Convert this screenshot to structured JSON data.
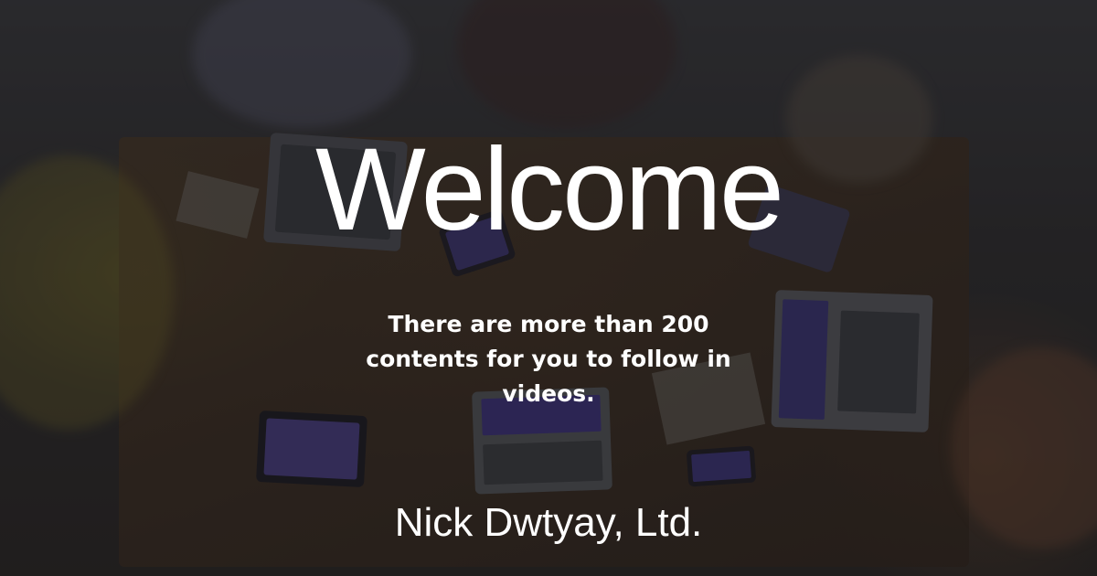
{
  "hero": {
    "title": "Welcome",
    "subtitle": "There are more than 200 contents for you to follow in videos.",
    "company": "Nick Dwtyay, Ltd."
  },
  "background": {
    "description_icon": "team-meeting-photo",
    "overlay_color": "#141416"
  }
}
